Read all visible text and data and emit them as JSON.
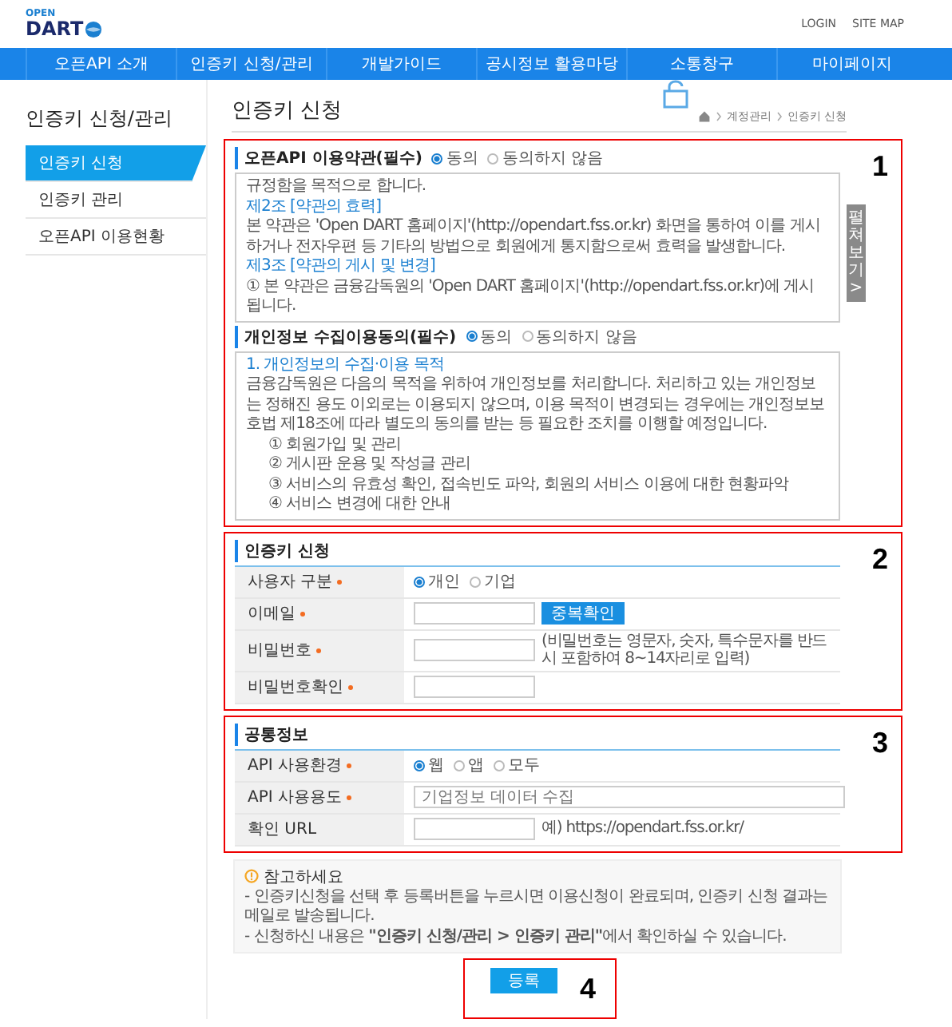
{
  "header": {
    "logo_top": "OPEN",
    "logo_main": "DART",
    "links": [
      "LOGIN",
      "SITE MAP"
    ]
  },
  "nav": [
    "오픈API 소개",
    "인증키 신청/관리",
    "개발가이드",
    "공시정보 활용마당",
    "소통창구",
    "마이페이지"
  ],
  "sidebar": {
    "title": "인증키 신청/관리",
    "items": [
      {
        "label": "인증키 신청",
        "selected": true
      },
      {
        "label": "인증키 관리",
        "selected": false
      },
      {
        "label": "오픈API 이용현황",
        "selected": false
      }
    ]
  },
  "page": {
    "title": "인증키 신청",
    "breadcrumb": [
      "계정관리",
      "인증키 신청"
    ]
  },
  "terms": {
    "title": "오픈API 이용약관(필수)",
    "options": [
      {
        "label": "동의",
        "selected": true
      },
      {
        "label": "동의하지 않음",
        "selected": false
      }
    ],
    "lines": [
      {
        "kind": "text",
        "text": "규정함을 목적으로 합니다."
      },
      {
        "kind": "heading",
        "text": "제2조 [약관의 효력]"
      },
      {
        "kind": "text",
        "text": "본 약관은 'Open DART 홈페이지'(http://opendart.fss.or.kr) 화면을 통하여 이를 게시하거나 전자우편 등 기타의 방법으로 회원에게 통지함으로써 효력을 발생합니다."
      },
      {
        "kind": "heading",
        "text": "제3조 [약관의 게시 및 변경]"
      },
      {
        "kind": "text",
        "text": "① 본 약관은 금융감독원의 'Open DART 홈페이지'(http://opendart.fss.or.kr)에 게시됩니다."
      }
    ],
    "expand": {
      "label": "펼쳐보기",
      "arrow": ">"
    }
  },
  "privacy": {
    "title": "개인정보 수집이용동의(필수)",
    "options": [
      {
        "label": "동의",
        "selected": true
      },
      {
        "label": "동의하지 않음",
        "selected": false
      }
    ],
    "lines": [
      {
        "kind": "heading",
        "text": "1. 개인정보의 수집·이용 목적"
      },
      {
        "kind": "text",
        "text": "금융감독원은 다음의 목적을 위하여 개인정보를 처리합니다. 처리하고 있는 개인정보는 정해진 용도 이외로는 이용되지 않으며, 이용 목적이 변경되는 경우에는 개인정보보호법 제18조에 따라 별도의 동의를 받는 등 필요한 조치를 이행할 예정입니다."
      },
      {
        "kind": "item",
        "text": "① 회원가입 및 관리"
      },
      {
        "kind": "item",
        "text": "② 게시판 운용 및 작성글 관리"
      },
      {
        "kind": "item",
        "text": "③ 서비스의 유효성 확인, 접속빈도 파악, 회원의 서비스 이용에 대한 현황파악"
      },
      {
        "kind": "item",
        "text": "④ 서비스 변경에 대한 안내"
      }
    ]
  },
  "key_application": {
    "title": "인증키 신청",
    "rows": [
      {
        "kind": "radio",
        "label": "사용자 구분",
        "required": true,
        "options": [
          {
            "label": "개인",
            "selected": true
          },
          {
            "label": "기업",
            "selected": false
          }
        ]
      },
      {
        "kind": "email",
        "label": "이메일",
        "required": true,
        "button": "중복확인"
      },
      {
        "kind": "password",
        "label": "비밀번호",
        "required": true,
        "hint": "(비밀번호는 영문자, 숫자, 특수문자를 반드시 포함하여 8~14자리로 입력)"
      },
      {
        "kind": "password",
        "label": "비밀번호확인",
        "required": true
      }
    ]
  },
  "common_info": {
    "title": "공통정보",
    "rows": [
      {
        "kind": "radio",
        "label": "API 사용환경",
        "required": true,
        "options": [
          {
            "label": "웹",
            "selected": true
          },
          {
            "label": "앱",
            "selected": false
          },
          {
            "label": "모두",
            "selected": false
          }
        ]
      },
      {
        "kind": "wide",
        "label": "API 사용용도",
        "required": true,
        "placeholder": "기업정보 데이터 수집"
      },
      {
        "kind": "url",
        "label": "확인 URL",
        "required": false,
        "hint": "예) https://opendart.fss.or.kr/"
      }
    ]
  },
  "notice": {
    "title": "참고하세요",
    "lines": [
      "- 인증키신청을 선택 후 등록버튼을 누르시면 이용신청이 완료되며, 인증키 신청 결과는 메일로 발송됩니다.",
      "- 신청하신 내용은 **\"인증키 신청/관리 > 인증키 관리\"**에서 확인하실 수 있습니다."
    ]
  },
  "submit": "등록",
  "annotations": [
    "1",
    "2",
    "3",
    "4"
  ]
}
